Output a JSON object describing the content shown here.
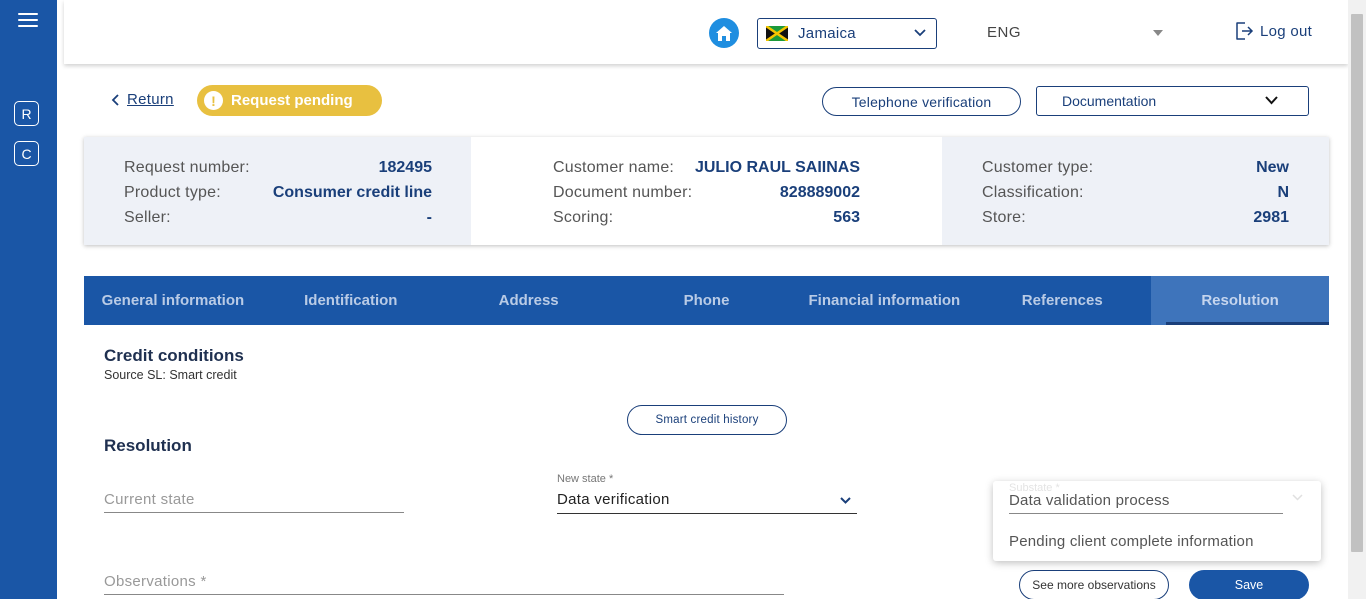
{
  "sidebar": {
    "letters": [
      "R",
      "C"
    ]
  },
  "header": {
    "country": "Jamaica",
    "language": "ENG",
    "logout_label": "Log out"
  },
  "actions": {
    "return_label": "Return",
    "status_badge": "Request pending",
    "telephone_verification": "Telephone verification",
    "documentation": "Documentation"
  },
  "info": {
    "col1": [
      {
        "label": "Request number:",
        "value": "182495"
      },
      {
        "label": "Product type:",
        "value": "Consumer credit line"
      },
      {
        "label": "Seller:",
        "value": "-"
      }
    ],
    "col2": [
      {
        "label": "Customer name:",
        "value": "JULIO RAUL SAIINAS"
      },
      {
        "label": "Document number:",
        "value": "828889002"
      },
      {
        "label": "Scoring:",
        "value": "563"
      }
    ],
    "col3": [
      {
        "label": "Customer type:",
        "value": "New"
      },
      {
        "label": "Classification:",
        "value": "N"
      },
      {
        "label": "Store:",
        "value": "2981"
      }
    ]
  },
  "tabs": [
    {
      "label": "General information"
    },
    {
      "label": "Identification"
    },
    {
      "label": "Address"
    },
    {
      "label": "Phone"
    },
    {
      "label": "Financial information"
    },
    {
      "label": "References"
    },
    {
      "label": "Resolution"
    }
  ],
  "content": {
    "credit_conditions_title": "Credit conditions",
    "source": "Source SL: Smart credit",
    "smart_credit_history": "Smart credit history",
    "resolution_title": "Resolution",
    "current_state_placeholder": "Current state",
    "new_state_label": "New state *",
    "new_state_value": "Data verification",
    "substate_label": "Substate *",
    "substate_options": [
      "Data validation process",
      "Pending client complete information"
    ],
    "observations_placeholder": "Observations *",
    "see_more_observations": "See more observations",
    "save_label": "Save"
  },
  "colors": {
    "primary": "#1a56a6",
    "dark_blue": "#1a3f7a",
    "badge_yellow": "#e8c040",
    "home_blue": "#1f8ee0"
  }
}
